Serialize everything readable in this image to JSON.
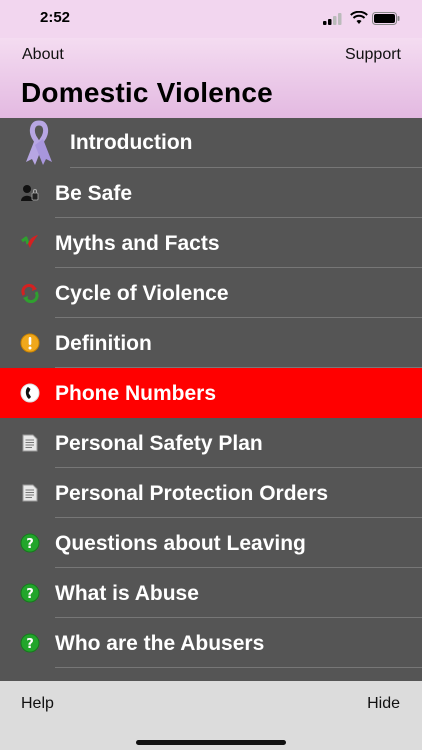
{
  "status": {
    "time": "2:52"
  },
  "header": {
    "about": "About",
    "support": "Support",
    "title": "Domestic Violence"
  },
  "menu": [
    {
      "label": "Introduction",
      "icon": "ribbon-icon"
    },
    {
      "label": "Be Safe",
      "icon": "person-lock-icon"
    },
    {
      "label": "Myths and Facts",
      "icon": "check-icon"
    },
    {
      "label": "Cycle of Violence",
      "icon": "cycle-icon"
    },
    {
      "label": "Definition",
      "icon": "exclamation-icon"
    },
    {
      "label": "Phone Numbers",
      "icon": "phone-icon",
      "active": true
    },
    {
      "label": "Personal Safety Plan",
      "icon": "document-icon"
    },
    {
      "label": "Personal Protection Orders",
      "icon": "document-icon"
    },
    {
      "label": "Questions about Leaving",
      "icon": "question-icon"
    },
    {
      "label": "What is Abuse",
      "icon": "question-icon"
    },
    {
      "label": "Who are the Abusers",
      "icon": "question-icon"
    }
  ],
  "footer": {
    "help": "Help",
    "hide": "Hide"
  },
  "colors": {
    "header": "#e8c3e6",
    "list_bg": "#555555",
    "active": "#ff0000",
    "text": "#ffffff"
  }
}
